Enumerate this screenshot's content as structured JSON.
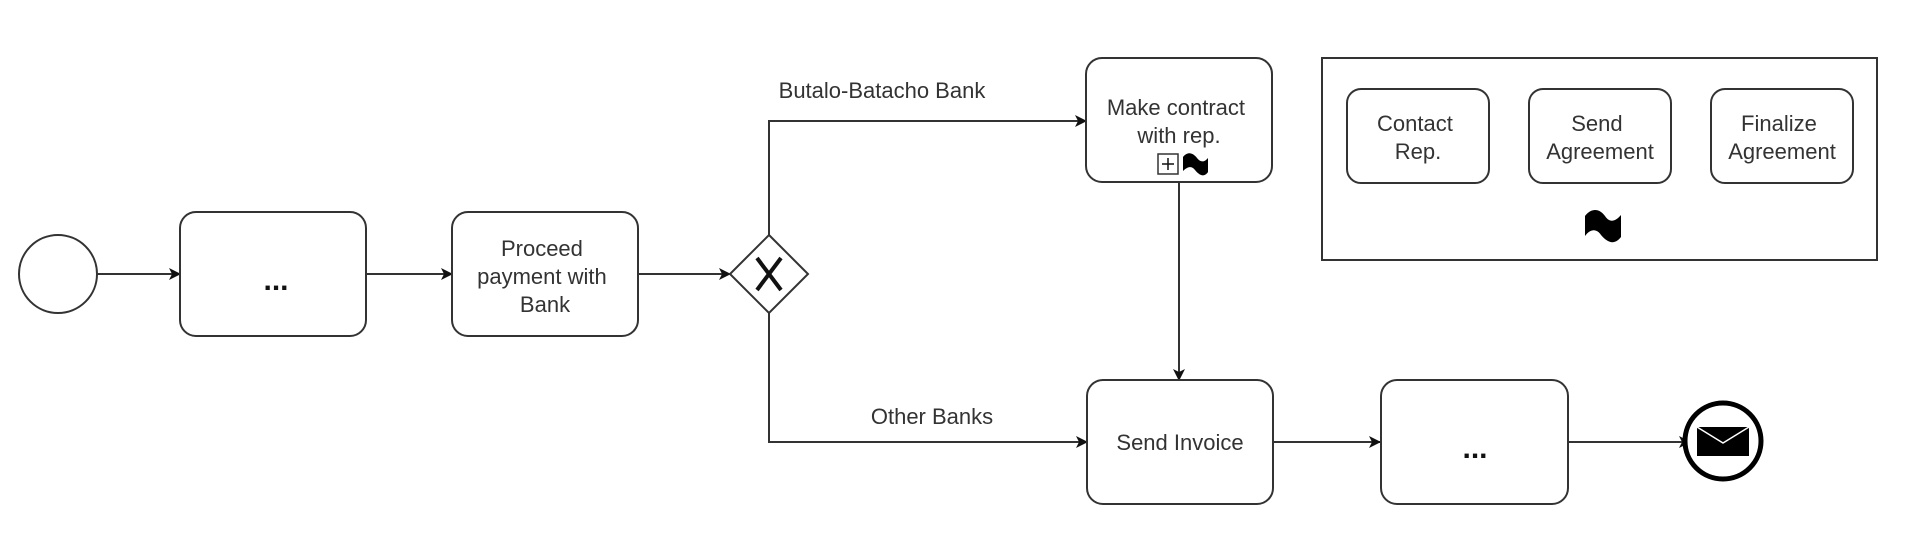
{
  "diagram": {
    "type": "BPMN process",
    "start_event": {
      "label": ""
    },
    "tasks": {
      "task1": {
        "label": "..."
      },
      "proceed_payment": {
        "lines": [
          "Proceed",
          "payment with",
          "Bank"
        ]
      },
      "make_contract": {
        "lines": [
          "Make contract",
          "with rep."
        ],
        "markers": [
          "collapsed-subprocess-plus",
          "ad-hoc-tilde"
        ]
      },
      "send_invoice": {
        "label": "Send Invoice"
      },
      "task_last": {
        "label": "..."
      }
    },
    "gateway": {
      "type": "exclusive",
      "symbol": "X"
    },
    "flows": {
      "upper_label": "Butalo-Batacho Bank",
      "lower_label": "Other Banks"
    },
    "end_event": {
      "type": "message end event",
      "icon": "envelope-icon"
    },
    "expanded_subprocess": {
      "tasks": [
        {
          "lines": [
            "Contact",
            "Rep."
          ]
        },
        {
          "lines": [
            "Send",
            "Agreement"
          ]
        },
        {
          "lines": [
            "Finalize",
            "Agreement"
          ]
        }
      ],
      "marker": "ad-hoc-tilde"
    },
    "colors": {
      "stroke": "#333333",
      "fill": "#ffffff",
      "text": "#333333"
    }
  }
}
